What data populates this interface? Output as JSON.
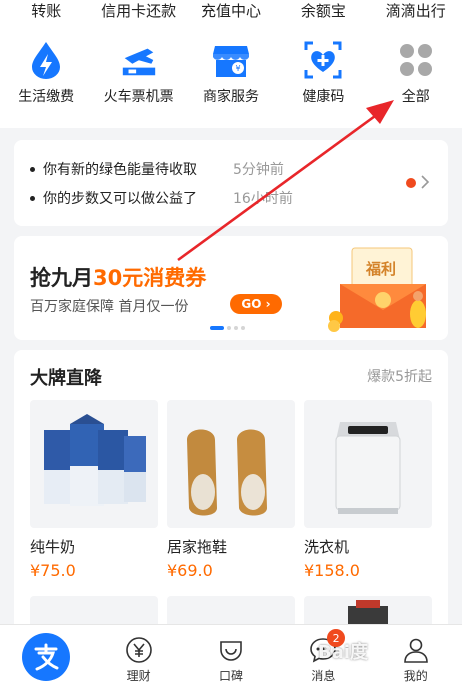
{
  "top_row": [
    "转账",
    "信用卡还款",
    "充值中心",
    "余额宝",
    "滴滴出行"
  ],
  "services": [
    {
      "label": "生活缴费",
      "icon": "lightning-drop-icon"
    },
    {
      "label": "火车票机票",
      "icon": "train-ticket-icon"
    },
    {
      "label": "商家服务",
      "icon": "store-icon"
    },
    {
      "label": "健康码",
      "icon": "health-code-icon"
    },
    {
      "label": "全部",
      "icon": "grid-all-icon"
    }
  ],
  "notices": [
    {
      "text": "你有新的绿色能量待收取",
      "time": "5分钟前"
    },
    {
      "text": "你的步数又可以做公益了",
      "time": "16小时前"
    }
  ],
  "promo": {
    "title_prefix": "抢九月",
    "title_highlight": "30元消费券",
    "subtitle": "百万家庭保障 首月仅一份",
    "go_label": "GO ›",
    "gift_label": "福利"
  },
  "brand": {
    "title": "大牌直降",
    "more": "爆款5折起",
    "products": [
      {
        "name": "纯牛奶",
        "price": "¥75.0"
      },
      {
        "name": "居家拖鞋",
        "price": "¥69.0"
      },
      {
        "name": "洗衣机",
        "price": "¥158.0"
      }
    ]
  },
  "tabbar": [
    {
      "label": "",
      "icon": "alipay-home-icon"
    },
    {
      "label": "理财",
      "icon": "yuan-coin-icon"
    },
    {
      "label": "口碑",
      "icon": "koubei-icon"
    },
    {
      "label": "消息",
      "icon": "message-icon",
      "badge": "2"
    },
    {
      "label": "我的",
      "icon": "person-icon"
    }
  ],
  "watermark": "Bai度",
  "colors": {
    "brand_blue": "#1677ff",
    "accent_orange": "#ff6a00",
    "alert_red": "#f04a1e",
    "annotation_red": "#e8262a"
  }
}
